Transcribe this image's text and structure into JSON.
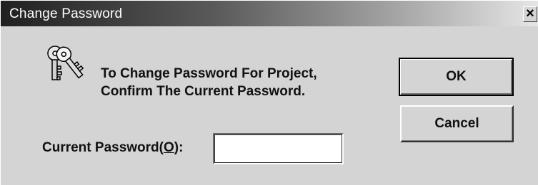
{
  "window": {
    "title": "Change Password",
    "close_glyph": "×"
  },
  "icon": "keys-icon",
  "message": {
    "line1": "To Change Password For Project,",
    "line2": "Confirm The Current Password."
  },
  "password": {
    "label_before": "Current Password(",
    "label_accel": "O",
    "label_after": "):",
    "value": "",
    "placeholder": ""
  },
  "buttons": {
    "ok_label": "OK",
    "cancel_label": "Cancel"
  }
}
